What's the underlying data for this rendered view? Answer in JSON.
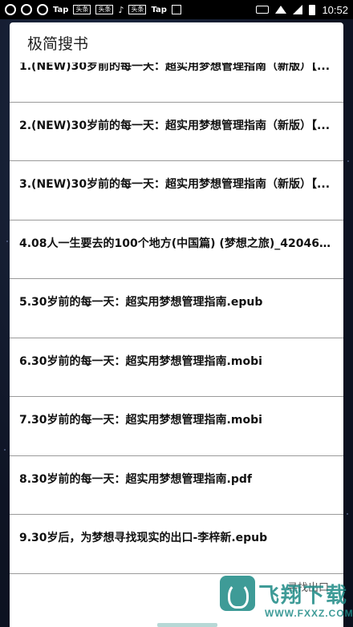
{
  "status_bar": {
    "chips": [
      "Tap",
      "头条",
      "头条",
      "Tap"
    ],
    "time": "10:52"
  },
  "dialog": {
    "title": "极简搜书",
    "results": [
      "1.(NEW)30岁前的每一天：超实用梦想管理指南（新版）【...",
      "2.(NEW)30岁前的每一天：超实用梦想管理指南（新版）【...",
      "3.(NEW)30岁前的每一天：超实用梦想管理指南（新版）【...",
      "4.08人一生要去的100个地方(中国篇) (梦想之旅)_4204616...",
      "5.30岁前的每一天：超实用梦想管理指南.epub",
      "6.30岁前的每一天：超实用梦想管理指南.mobi",
      "7.30岁前的每一天：超实用梦想管理指南.mobi",
      "8.30岁前的每一天：超实用梦想管理指南.pdf",
      "9.30岁后，为梦想寻找现实的出口-李梓新.epub"
    ],
    "bottom_action": "寻找出口"
  },
  "watermark": {
    "name": "飞翔下载",
    "url": "WWW.FXXZ.COM"
  },
  "colors": {
    "accent": "#1d8a86",
    "divider": "#9a9a9a"
  }
}
